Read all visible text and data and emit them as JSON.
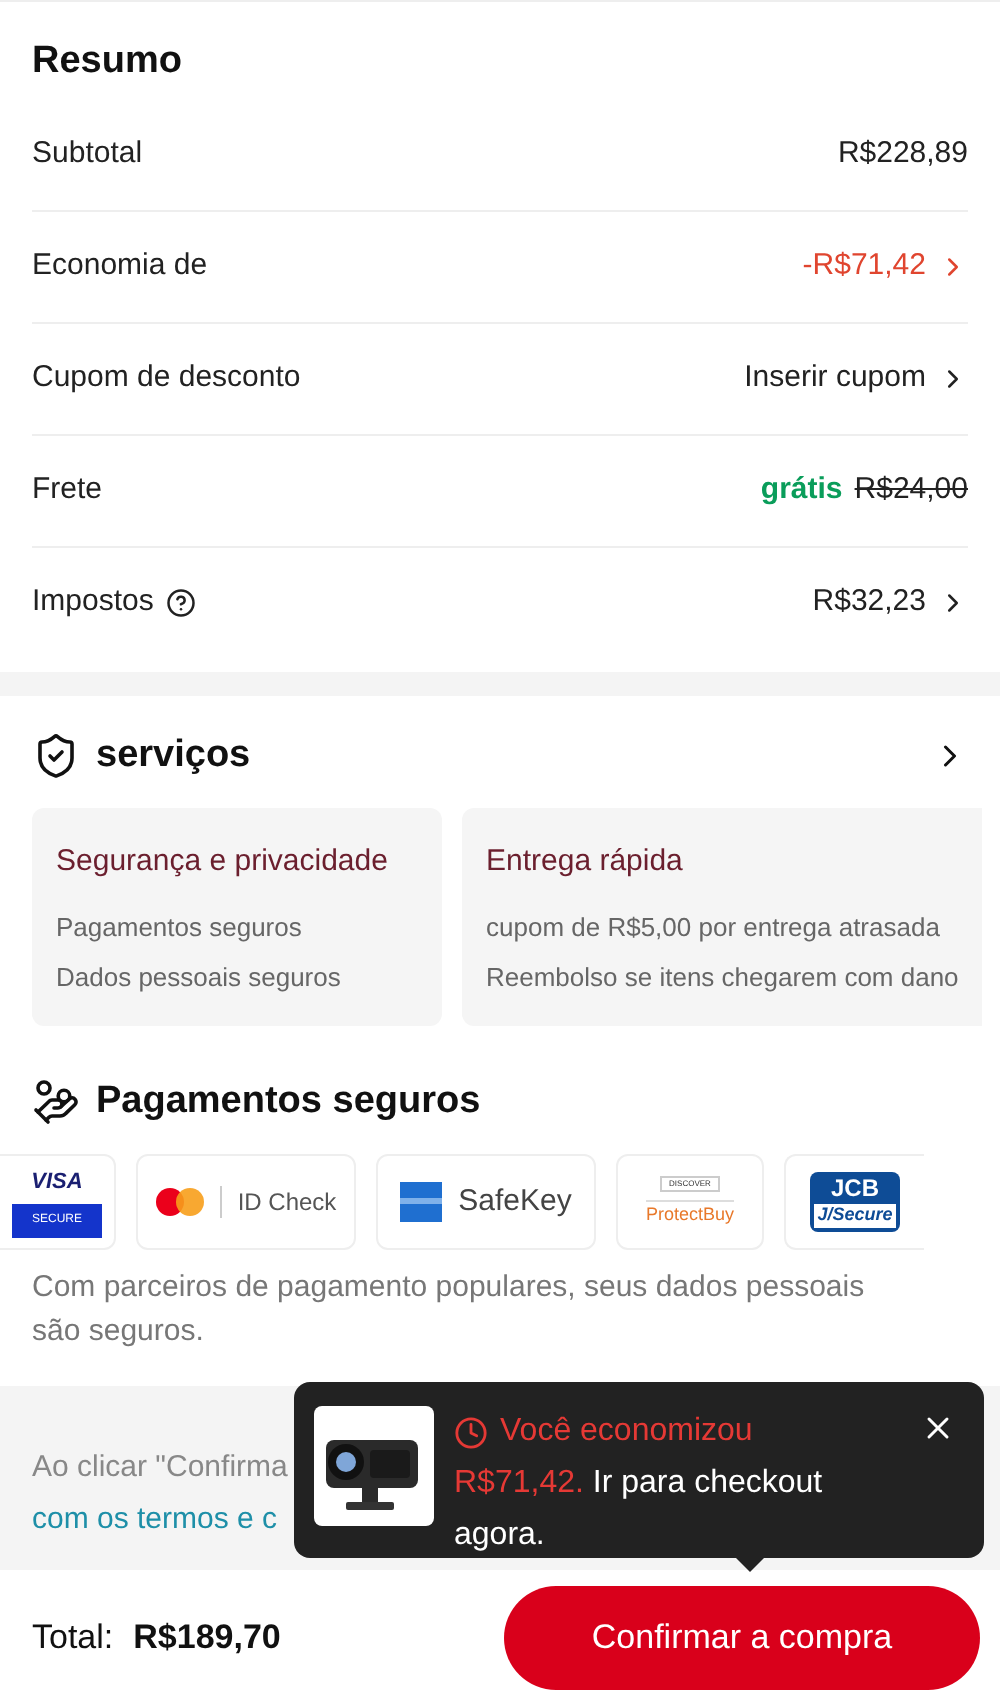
{
  "summary": {
    "title": "Resumo",
    "rows": [
      {
        "kind": "plain",
        "label": "Subtotal",
        "value": "R$228,89",
        "chevron": false,
        "help": false
      },
      {
        "kind": "discount",
        "label": "Economia de",
        "value": "-R$71,42",
        "chevron": true,
        "help": false
      },
      {
        "kind": "plain",
        "label": "Cupom de desconto",
        "value": "Inserir cupom",
        "chevron": true,
        "help": false
      },
      {
        "kind": "shipping",
        "label": "Frete",
        "value": "grátis",
        "old_value": "R$24,00",
        "chevron": false,
        "help": false
      },
      {
        "kind": "plain",
        "label": "Impostos",
        "value": "R$32,23",
        "chevron": true,
        "help": true
      }
    ]
  },
  "services": {
    "title": "serviços",
    "cards": [
      {
        "title": "Segurança e privacidade",
        "lines": [
          "Pagamentos seguros",
          "Dados pessoais seguros"
        ]
      },
      {
        "title": "Entrega rápida",
        "lines": [
          "cupom de R$5,00 por entrega atrasada",
          "Reembolso se itens chegarem com dano"
        ]
      }
    ]
  },
  "payments": {
    "title": "Pagamentos seguros",
    "logos": [
      {
        "kind": "visa",
        "texts": [
          "VISA",
          "SECURE"
        ]
      },
      {
        "kind": "mastercard",
        "texts": [
          "ID Check"
        ]
      },
      {
        "kind": "amex",
        "texts": [
          "SafeKey"
        ]
      },
      {
        "kind": "discover",
        "texts": [
          "DISCOVER",
          "ProtectBuy"
        ]
      },
      {
        "kind": "jcb",
        "texts": [
          "JCB",
          "J/Secure"
        ]
      }
    ],
    "note": "Com parceiros de pagamento populares, seus dados pessoais são seguros."
  },
  "legal": {
    "line_1": "Ao clicar \"Confirma",
    "link": "com os termos e c"
  },
  "toast": {
    "title": "Você economizou",
    "amount": "R$71,42.",
    "message": "Ir para checkout agora."
  },
  "footer": {
    "total_label": "Total:",
    "total": "R$189,70",
    "button": "Confirmar a compra"
  }
}
